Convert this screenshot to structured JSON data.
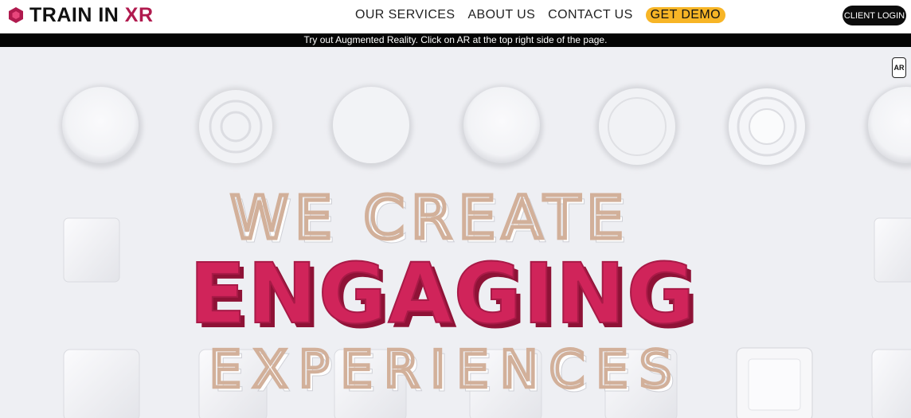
{
  "brand": {
    "name_primary": "TRAIN IN",
    "name_accent": "XR",
    "icon": "hexagon-logo-icon",
    "accent_color": "#b01a4e"
  },
  "nav": {
    "items": [
      {
        "label": "OUR SERVICES"
      },
      {
        "label": "ABOUT US"
      },
      {
        "label": "CONTACT US"
      }
    ],
    "demo_label": "GET DEMO",
    "demo_color": "#f7b526",
    "client_login_label": "CLIENT LOGIN"
  },
  "announcement": {
    "text": "Try out Augmented Reality. Click on AR at the top right side of the page."
  },
  "hero": {
    "ar_button_label": "AR",
    "line1": "WE CREATE",
    "line2": "ENGAGING",
    "line3": "EXPERIENCES",
    "line1_color": "#d2b09a",
    "line2_color": "#d0245a",
    "line3_color": "#d2b09a",
    "background_color": "#eeeff3"
  }
}
